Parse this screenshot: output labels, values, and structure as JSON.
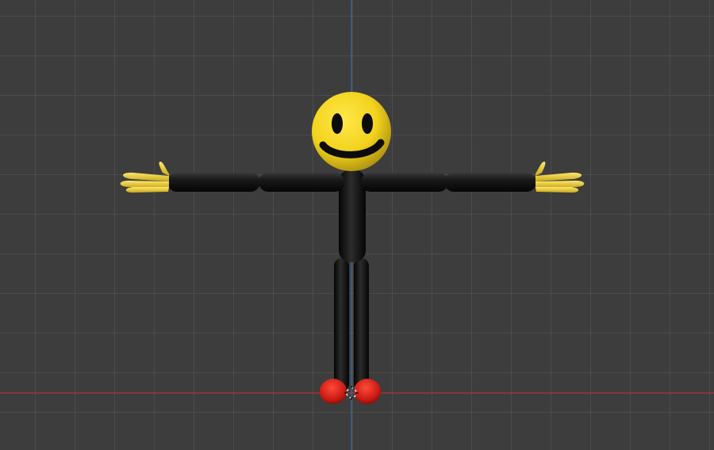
{
  "viewport": {
    "background": "#3d3d3d",
    "grid_color": "#4a4a4a",
    "x_axis_color": "#c0333a",
    "z_axis_color": "#3d6fb0"
  },
  "character": {
    "head_color": "#f2d21c",
    "body_color": "#111111",
    "hand_color": "#f2cf2a",
    "shoe_color": "#d41e16",
    "icon": "smiley-face-icon"
  }
}
